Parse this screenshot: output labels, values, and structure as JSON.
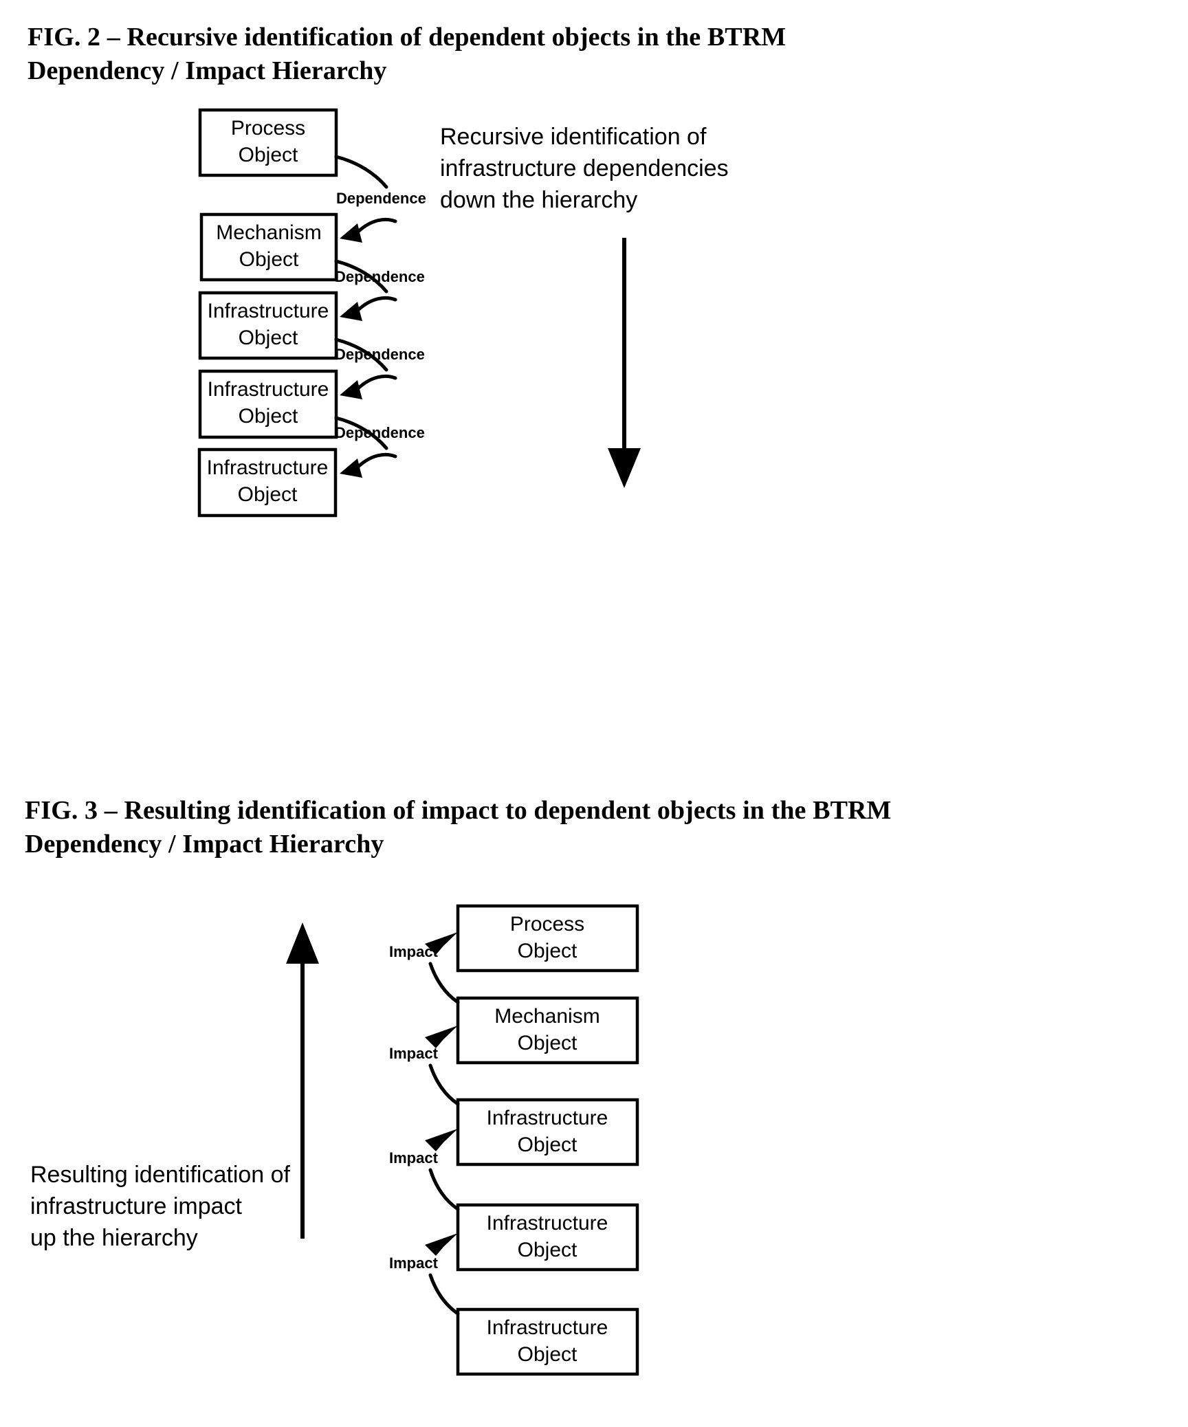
{
  "document": {
    "type": "patent-figure-sheet",
    "background_color": "#ffffff",
    "ink_color": "#000000"
  },
  "figures": [
    {
      "id": "fig2",
      "caption": "FIG. 2 – Recursive identification of dependent objects in the BTRM\nDependency / Impact Hierarchy",
      "caption_line1": "FIG. 2 – Recursive identification of dependent objects in the BTRM",
      "caption_line2": "Dependency / Impact Hierarchy",
      "boxes": [
        {
          "line1": "Process",
          "line2": "Object"
        },
        {
          "line1": "Mechanism",
          "line2": "Object"
        },
        {
          "line1": "Infrastructure",
          "line2": "Object"
        },
        {
          "line1": "Infrastructure",
          "line2": "Object"
        },
        {
          "line1": "Infrastructure",
          "line2": "Object"
        }
      ],
      "edge_labels": [
        "Dependence",
        "Dependence",
        "Dependence",
        "Dependence"
      ],
      "side_note": {
        "line1": "Recursive identification of",
        "line2": "infrastructure dependencies",
        "line3": "down the hierarchy"
      },
      "flow_direction": "down"
    },
    {
      "id": "fig3",
      "caption": "FIG. 3 – Resulting identification of impact to dependent objects in the BTRM\nDependency / Impact Hierarchy",
      "caption_line1": "FIG. 3 – Resulting identification of impact to dependent objects in the BTRM",
      "caption_line2": "Dependency / Impact Hierarchy",
      "boxes": [
        {
          "line1": "Process",
          "line2": "Object"
        },
        {
          "line1": "Mechanism",
          "line2": "Object"
        },
        {
          "line1": "Infrastructure",
          "line2": "Object"
        },
        {
          "line1": "Infrastructure",
          "line2": "Object"
        },
        {
          "line1": "Infrastructure",
          "line2": "Object"
        }
      ],
      "edge_labels": [
        "Impact",
        "Impact",
        "Impact",
        "Impact"
      ],
      "side_note": {
        "line1": "Resulting identification of",
        "line2": "infrastructure impact",
        "line3": "up the hierarchy"
      },
      "flow_direction": "up"
    }
  ]
}
